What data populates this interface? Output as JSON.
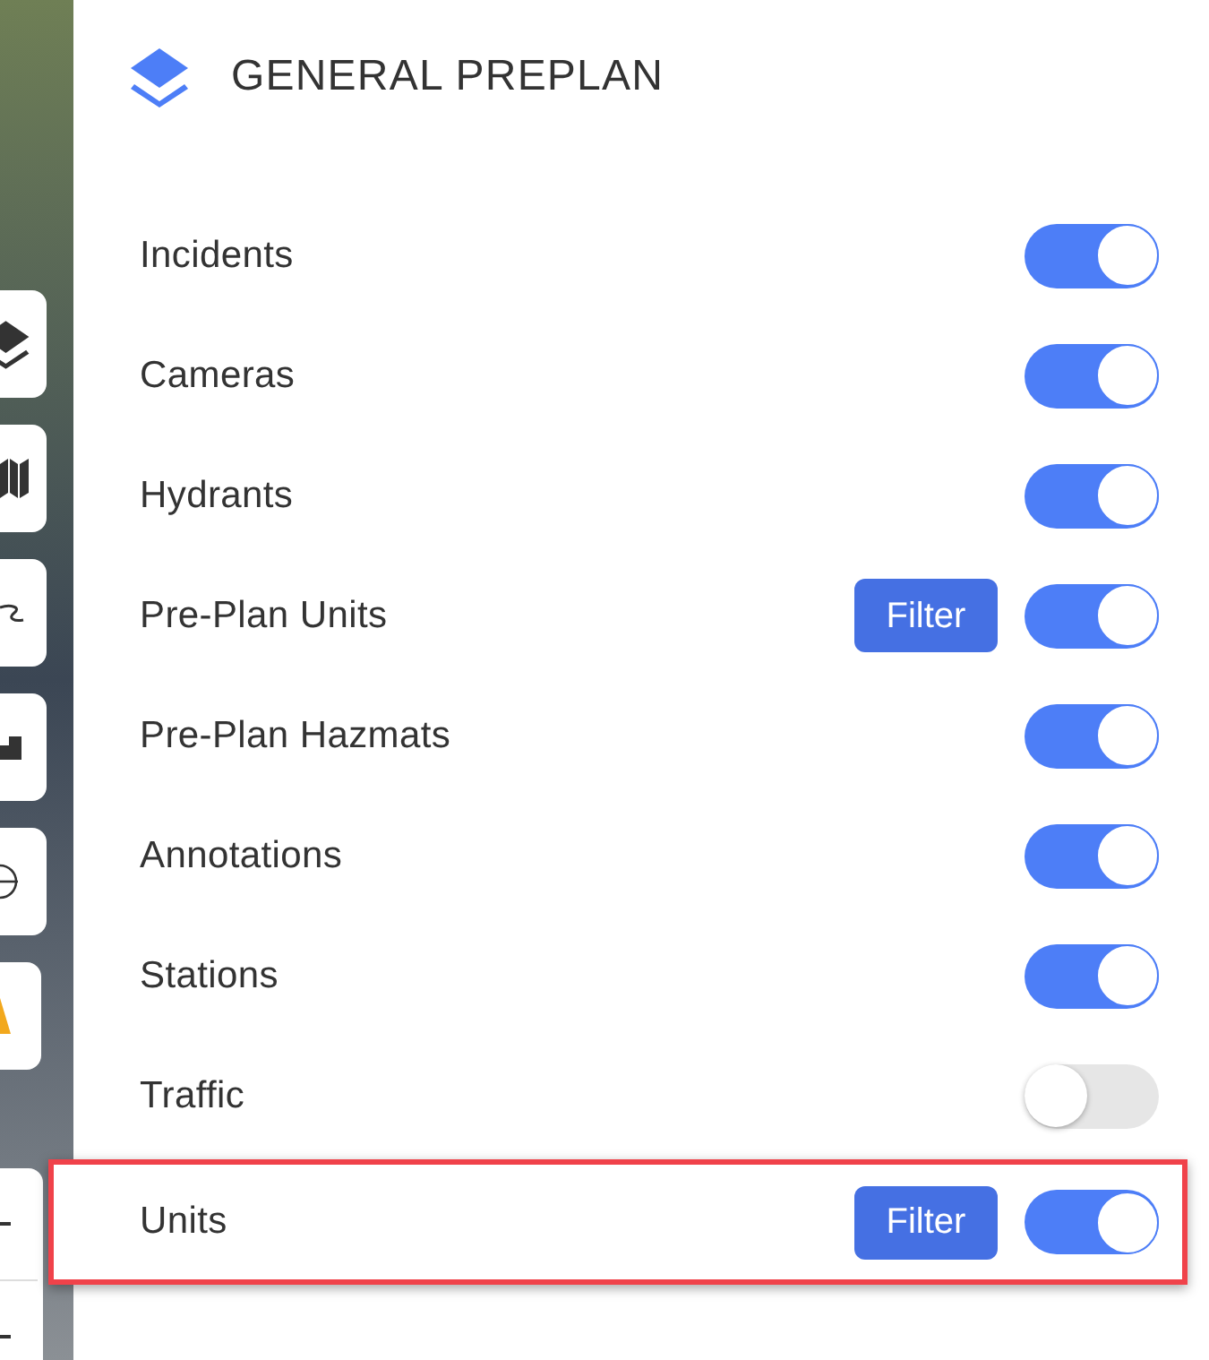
{
  "header": {
    "title": "GENERAL PREPLAN"
  },
  "layers": [
    {
      "label": "Incidents",
      "on": true,
      "highlighted": false
    },
    {
      "label": "Cameras",
      "on": true,
      "highlighted": false
    },
    {
      "label": "Hydrants",
      "on": true,
      "highlighted": false
    },
    {
      "label": "Pre-Plan Units",
      "filter_button": "Filter",
      "on": true,
      "highlighted": false
    },
    {
      "label": "Pre-Plan Hazmats",
      "on": true,
      "highlighted": false
    },
    {
      "label": "Annotations",
      "on": true,
      "highlighted": false
    },
    {
      "label": "Stations",
      "on": true,
      "highlighted": false
    },
    {
      "label": "Traffic",
      "on": false,
      "highlighted": false
    },
    {
      "label": "Units",
      "filter_button": "Filter",
      "on": true,
      "highlighted": true
    }
  ]
}
